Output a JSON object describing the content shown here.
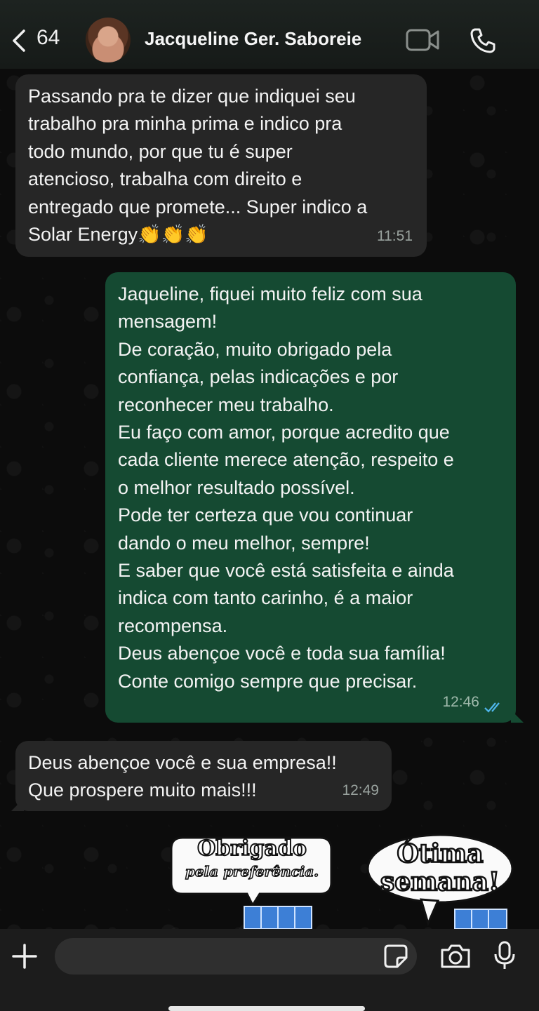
{
  "header": {
    "back_count": "64",
    "contact_name": "Jacqueline Ger. Saboreie"
  },
  "messages": [
    {
      "direction": "incoming",
      "text": "Passando pra te dizer que indiquei seu\ntrabalho pra minha prima e indico pra\ntodo mundo, por que tu é super\natencioso, trabalha com direito e\nentregado que promete... Super indico a\nSolar Energy👏👏👏",
      "time": "11:51"
    },
    {
      "direction": "outgoing",
      "text": "Jaqueline, fiquei muito feliz com sua\nmensagem!\nDe coração, muito obrigado pela\nconfiança, pelas indicações e por\nreconhecer meu trabalho.\nEu faço com amor, porque acredito que\ncada cliente merece atenção, respeito e\no melhor resultado possível.\nPode ter certeza que vou continuar\ndando o meu melhor, sempre!\nE saber que você está satisfeita e ainda\nindica com tanto carinho, é a maior\nrecompensa.\nDeus abençoe você e toda sua família!\nConte comigo sempre que precisar.",
      "time": "12:46",
      "status": "read"
    },
    {
      "direction": "incoming",
      "text": "Deus abençoe você e sua empresa!!\nQue prospere muito mais!!!",
      "time": "12:49"
    }
  ],
  "stickers": [
    {
      "line1": "Obrigado",
      "line2": "pela preferência."
    },
    {
      "line1": "Ótima",
      "line2": "semana!"
    }
  ],
  "composer": {
    "placeholder": ""
  },
  "colors": {
    "incoming_bubble": "#262626",
    "outgoing_bubble": "#154a32",
    "read_ticks": "#4fb6ec"
  }
}
